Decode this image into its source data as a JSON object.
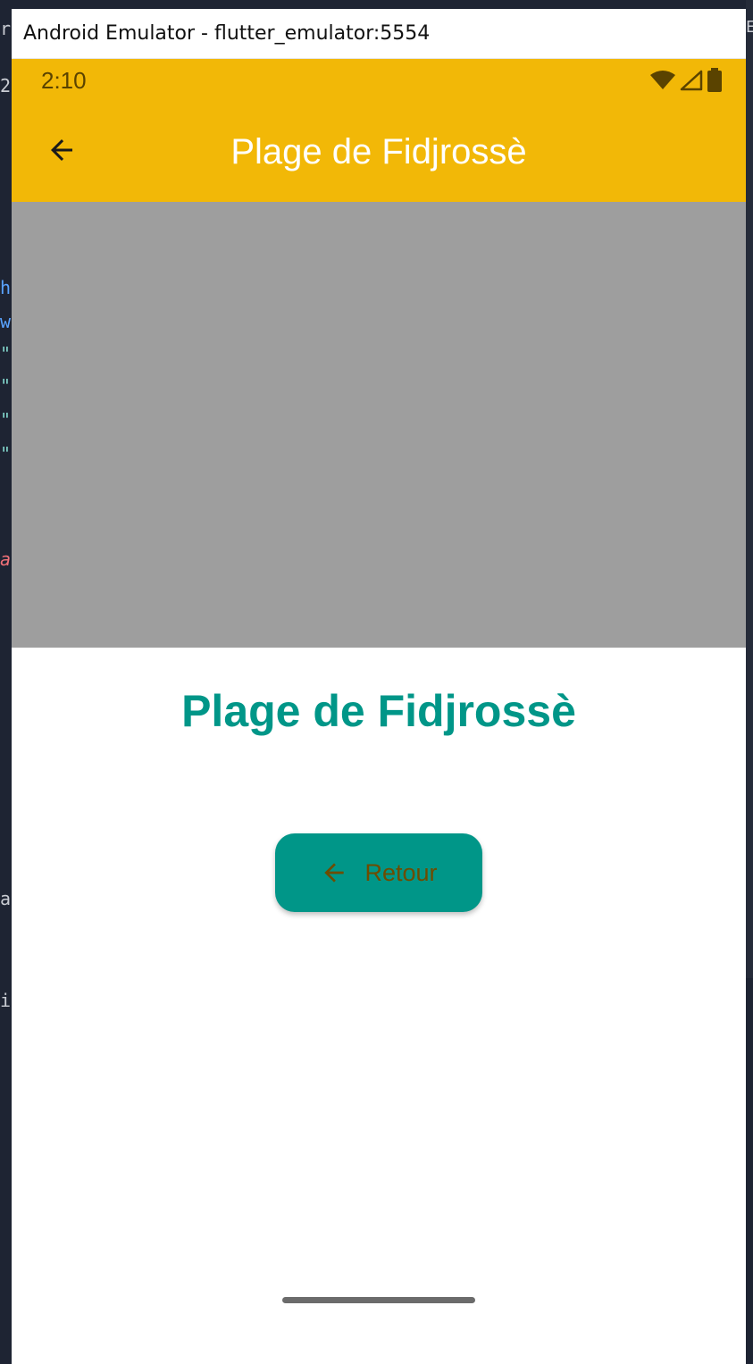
{
  "window": {
    "title": "Android Emulator - flutter_emulator:5554"
  },
  "background_editor": {
    "left_glyphs": [
      {
        "char": "h",
        "color": "#5aa3ff"
      },
      {
        "char": "w",
        "color": "#5aa3ff"
      },
      {
        "char": "\"",
        "color": "#7fd1c8"
      },
      {
        "char": "\"",
        "color": "#7fd1c8"
      },
      {
        "char": "\"",
        "color": "#7fd1c8"
      },
      {
        "char": "\"",
        "color": "#7fd1c8"
      },
      {
        "char": "a",
        "color": "#f07178"
      },
      {
        "char": "a",
        "color": "#c9ccd3"
      },
      {
        "char": "i",
        "color": "#c9ccd3"
      }
    ],
    "right_glyph": "E"
  },
  "status_bar": {
    "time": "2:10",
    "icons": [
      "wifi-icon",
      "signal-icon",
      "battery-icon"
    ]
  },
  "app_bar": {
    "title": "Plage de Fidjrossè",
    "back_icon": "arrow-back-icon"
  },
  "image": {
    "color": "#9e9e9e"
  },
  "content": {
    "place_name": "Plage de Fidjrossè",
    "button": {
      "label": "Retour",
      "icon": "arrow-back-icon"
    }
  },
  "colors": {
    "app_bar": "#f2b807",
    "accent": "#009688",
    "button_text": "#6d4c00"
  }
}
